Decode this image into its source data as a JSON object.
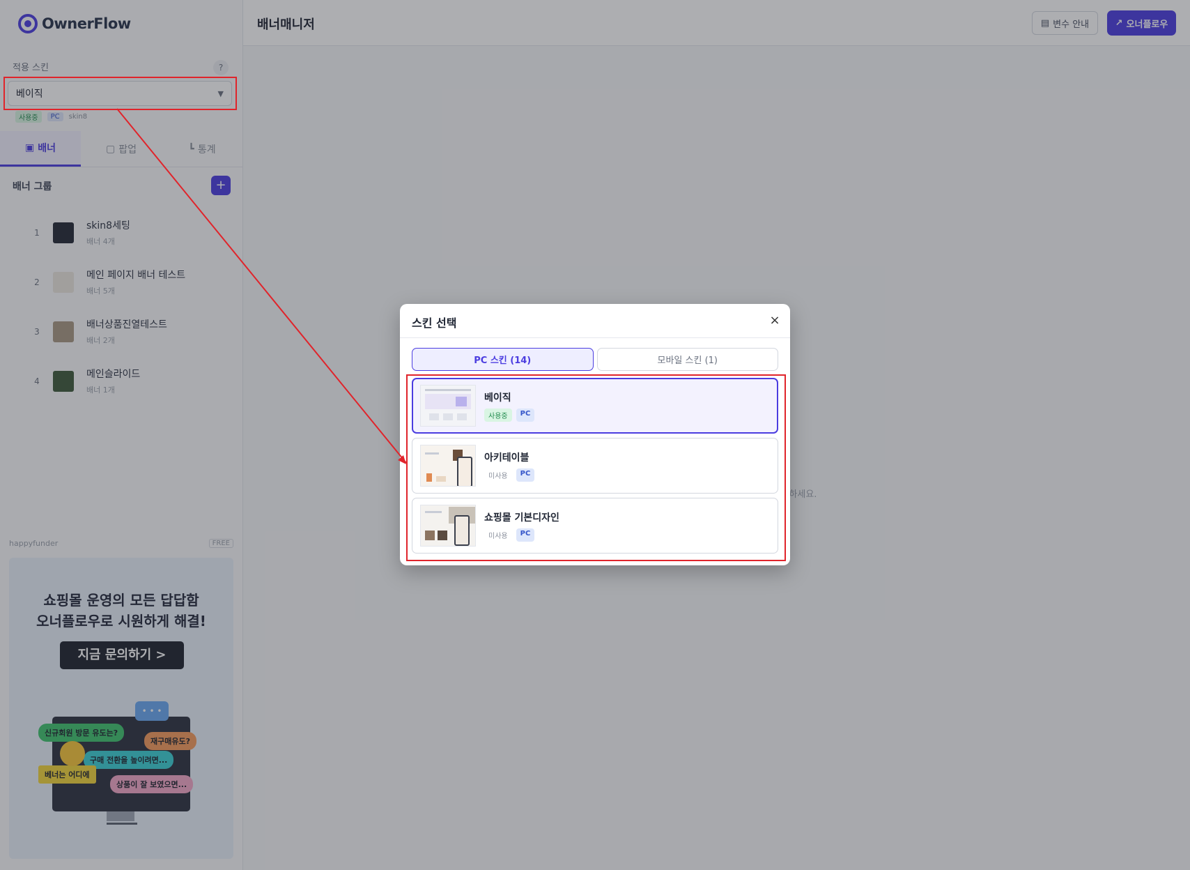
{
  "app": {
    "name": "OwnerFlow"
  },
  "sidebar": {
    "skin_label": "적용 스킨",
    "help": "?",
    "skin_select": {
      "value": "베이직"
    },
    "skin_meta": {
      "status": "사용중",
      "device": "PC",
      "code": "skin8"
    },
    "tabs": [
      {
        "label": "배너"
      },
      {
        "label": "팝업"
      },
      {
        "label": "통계"
      }
    ],
    "group_label": "배너 그룹",
    "add": "+",
    "banners": [
      {
        "num": "1",
        "name": "skin8세팅",
        "count": "배너 4개"
      },
      {
        "num": "2",
        "name": "메인 페이지 배너 테스트",
        "count": "배너 5개"
      },
      {
        "num": "3",
        "name": "배너상품진열테스트",
        "count": "배너 2개"
      },
      {
        "num": "4",
        "name": "메인슬라이드",
        "count": "배너 1개"
      }
    ],
    "promo": {
      "provider": "happyfunder",
      "badge": "FREE",
      "title_line1": "쇼핑몰 운영의 모든 답답함",
      "title_line2": "오너플로우로 시원하게 해결!",
      "cta": "지금 문의하기 >",
      "bubbles": [
        "신규회원 방문 유도는?",
        "재구매유도?",
        "구매 전환을 높이려면...",
        "베너는 어디에",
        "상품이 잘 보였으면..."
      ],
      "chat": "• • •"
    }
  },
  "topbar": {
    "title": "배너매니저",
    "guide_btn": "변수 안내",
    "owner_btn": "오너플로우"
  },
  "main": {
    "empty_hint": "...하세요."
  },
  "modal": {
    "title": "스킨 선택",
    "close": "×",
    "tabs": [
      {
        "label": "PC 스킨 (14)"
      },
      {
        "label": "모바일 스킨 (1)"
      }
    ],
    "skins": [
      {
        "name": "베이직",
        "status": "사용중",
        "device": "PC"
      },
      {
        "name": "아키테이블",
        "status": "미사용",
        "device": "PC"
      },
      {
        "name": "쇼핑몰 기본디자인",
        "status": "미사용",
        "device": "PC"
      }
    ]
  },
  "colors": {
    "accent": "#4b3de0",
    "highlight": "#e0242b",
    "in_use": "#1f8a4c"
  }
}
